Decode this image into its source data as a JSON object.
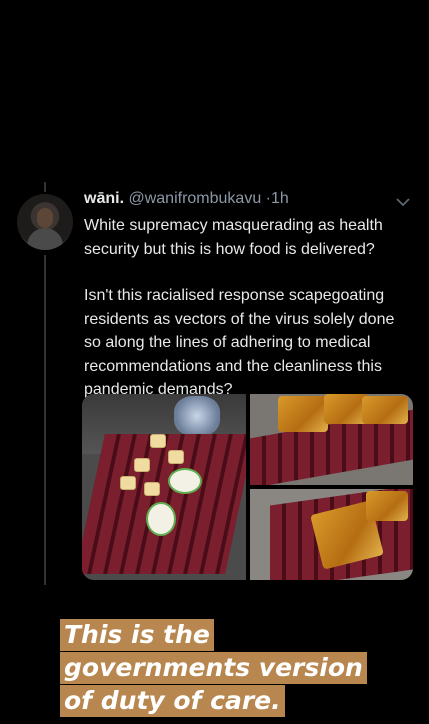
{
  "tweet": {
    "display_name": "wāni.",
    "handle": "@wanifrombukavu",
    "separator": "·",
    "time": "1h",
    "paragraphs": [
      "White supremacy masquerading as health security but this is how food is delivered?",
      "Isn't this racialised response scapegoating residents as vectors of the virus solely done so along the lines of adhering to medical recommendations and the cleanliness this pandemic demands?"
    ],
    "caret_icon": "chevron-down-icon"
  },
  "caption": {
    "lines": [
      "This is the",
      "governments version",
      "of duty of care."
    ]
  },
  "colors": {
    "background": "#000000",
    "caption_highlight": "#b8874f",
    "table_red": "#7b1e2e"
  }
}
